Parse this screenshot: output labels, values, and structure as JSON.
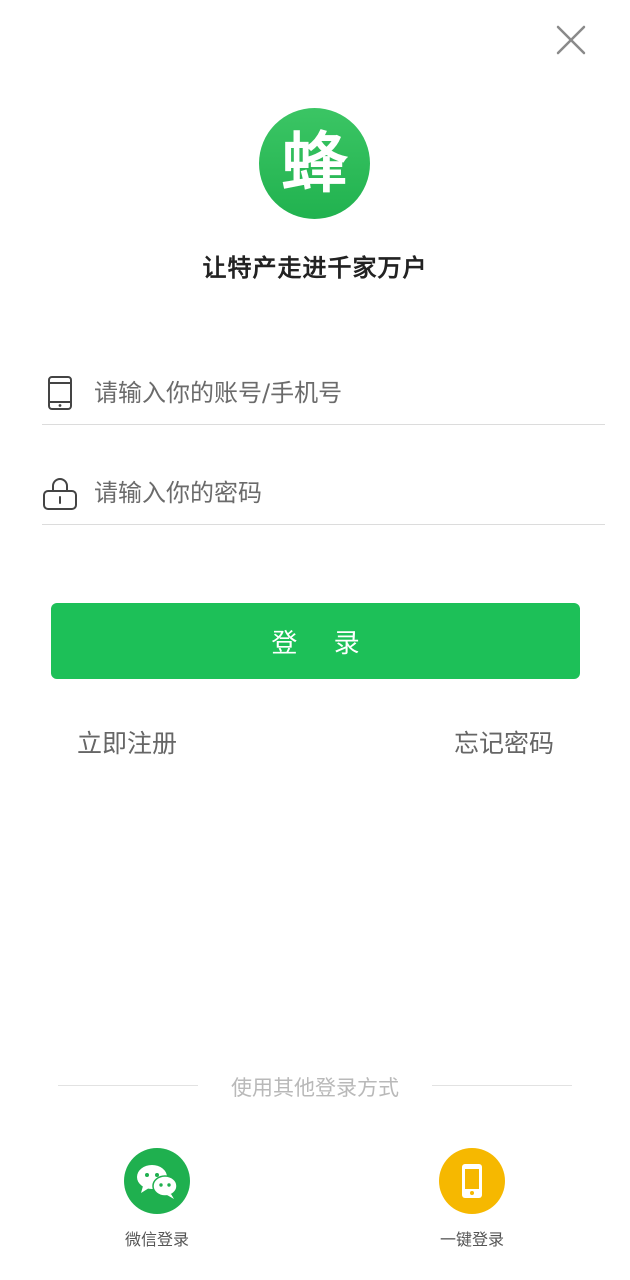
{
  "header": {
    "close_icon": "close-icon"
  },
  "brand": {
    "logo_char": "蜂",
    "logo_color": "#2bbb57",
    "slogan": "让特产走进千家万户"
  },
  "form": {
    "account_placeholder": "请输入你的账号/手机号",
    "account_value": "",
    "account_icon": "phone-icon",
    "password_placeholder": "请输入你的密码",
    "password_value": "",
    "password_icon": "lock-icon",
    "login_label": "登 录",
    "login_color": "#1dc058"
  },
  "links": {
    "register": "立即注册",
    "forgot": "忘记密码"
  },
  "alt_login": {
    "divider_text": "使用其他登录方式",
    "options": [
      {
        "label": "微信登录",
        "icon": "wechat-icon",
        "color": "#1fb04f"
      },
      {
        "label": "一键登录",
        "icon": "mobile-icon",
        "color": "#f6b800"
      }
    ]
  }
}
